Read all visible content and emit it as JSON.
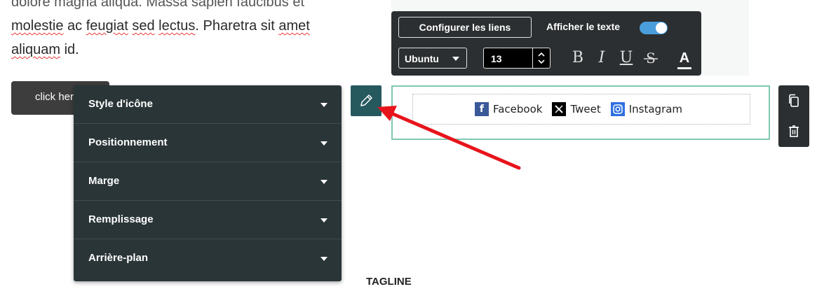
{
  "content": {
    "line1": "dolore magna aliqua. Massa sapien faucibus et",
    "line2_words": [
      "molestie",
      " ac ",
      "feugiat",
      " ",
      "sed",
      " ",
      "lectus",
      ". Pharetra sit ",
      "amet"
    ],
    "line3_words": [
      "aliquam",
      " id."
    ],
    "cta_button": "click here",
    "tagline": "TAGLINE"
  },
  "toolbar": {
    "configure_links": "Configurer les liens",
    "show_text_label": "Afficher le texte",
    "show_text_on": true,
    "font_family": "Ubuntu",
    "font_size": "13",
    "bold": "B",
    "italic": "I",
    "underline": "U",
    "strikethrough": "S",
    "text_color": "A"
  },
  "social": [
    {
      "name": "Facebook",
      "icon": "facebook-icon"
    },
    {
      "name": "Tweet",
      "icon": "x-twitter-icon"
    },
    {
      "name": "Instagram",
      "icon": "instagram-icon"
    }
  ],
  "style_menu": [
    {
      "label": "Style d'icône"
    },
    {
      "label": "Positionnement"
    },
    {
      "label": "Marge"
    },
    {
      "label": "Remplissage"
    },
    {
      "label": "Arrière-plan"
    }
  ],
  "colors": {
    "panel": "#2a3538",
    "toolbar": "#2b2f31",
    "edit_button": "#26595e",
    "selection_outline": "#7fc8b0",
    "toggle_on": "#4a9edc",
    "annotation_arrow": "#e8141b"
  }
}
